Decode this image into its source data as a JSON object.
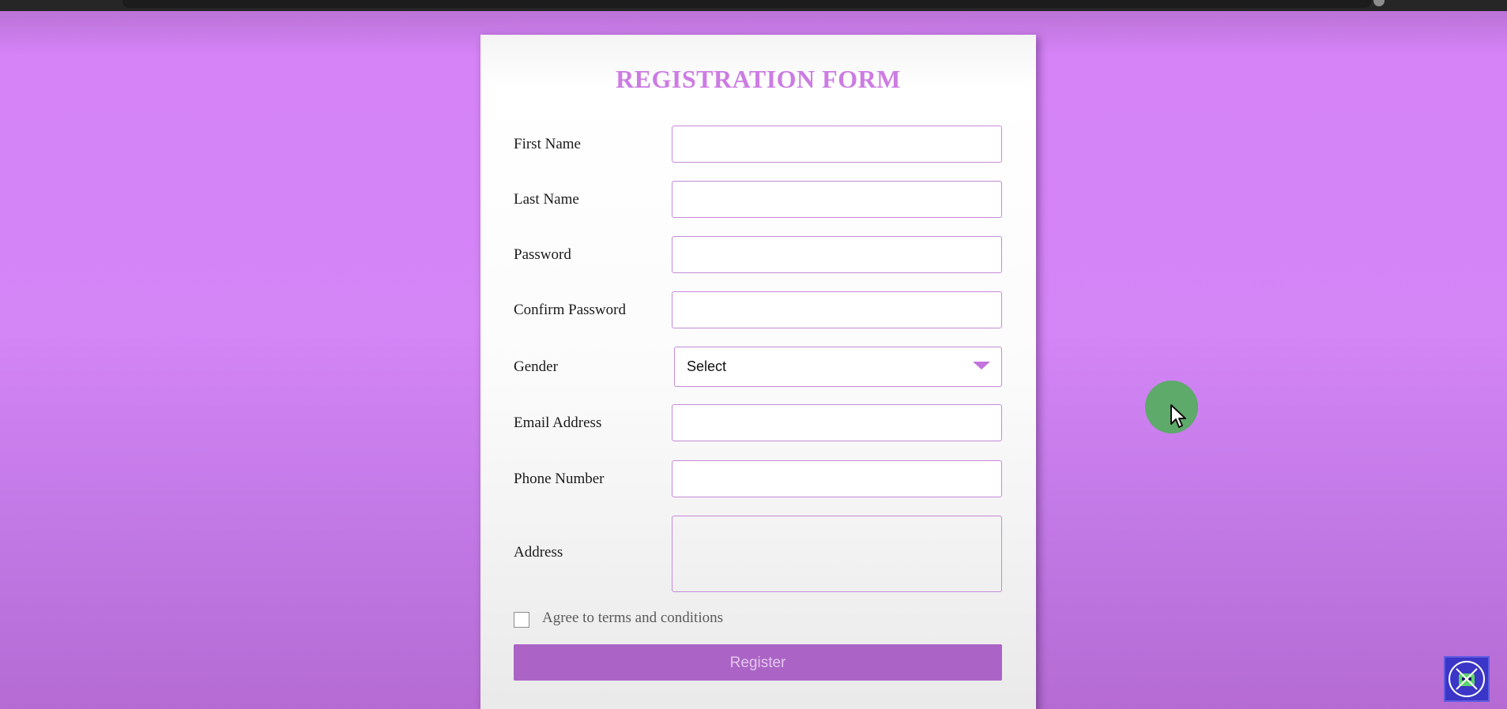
{
  "form": {
    "title": "REGISTRATION FORM",
    "fields": {
      "first_name": {
        "label": "First Name",
        "value": ""
      },
      "last_name": {
        "label": "Last Name",
        "value": ""
      },
      "password": {
        "label": "Password",
        "value": ""
      },
      "confirm_password": {
        "label": "Confirm Password",
        "value": ""
      },
      "gender": {
        "label": "Gender",
        "selected": "Select"
      },
      "email": {
        "label": "Email Address",
        "value": ""
      },
      "phone": {
        "label": "Phone Number",
        "value": ""
      },
      "address": {
        "label": "Address",
        "value": ""
      }
    },
    "terms": {
      "label": "Agree to terms and conditions",
      "checked": false
    },
    "register_label": "Register"
  },
  "colors": {
    "background": "#d583f7",
    "title": "#cc7ce3",
    "field_border": "#c48ad8",
    "button": "#ab64c5",
    "button_text": "#e3c6ee",
    "cursor_halo": "#5daa6a"
  },
  "icons": {
    "dropdown": "chevron-down-icon",
    "cursor": "mouse-cursor-icon",
    "channel_logo": "channel-logo-icon"
  }
}
